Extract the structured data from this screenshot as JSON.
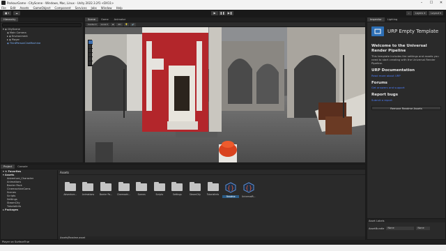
{
  "window": {
    "title": "ParkourGame - CityScene - Windows, Mac, Linux - Unity 2022.3.2f1 <DX11>"
  },
  "window_controls": {
    "min": "–",
    "max": "☐",
    "close": "✕"
  },
  "menu": [
    "File",
    "Edit",
    "Assets",
    "GameObject",
    "Component",
    "Services",
    "Jobs",
    "Window",
    "Help"
  ],
  "toolbar": {
    "left": [
      "■ ▾",
      "☁"
    ],
    "right": [
      "Layers ▾",
      "Layout ▾"
    ]
  },
  "hierarchy": {
    "tab": "Hierarchy",
    "rows": [
      {
        "label": "▾ ◈ CityScene",
        "indent": 0,
        "blue": false
      },
      {
        "label": "◈ Main Camera",
        "indent": 1,
        "blue": false
      },
      {
        "label": "▸ ◈ Environment",
        "indent": 1,
        "blue": false
      },
      {
        "label": "▸ ◈ Player",
        "indent": 1,
        "blue": false
      },
      {
        "label": "◈ ThirdPersonCineMachine",
        "indent": 1,
        "blue": true
      }
    ]
  },
  "scene": {
    "tabs": [
      "Scene",
      "Game",
      "Animator"
    ],
    "tools": [
      "Center ▾",
      "Local ▾",
      "⊞",
      "2D",
      "💡",
      "🔊"
    ]
  },
  "inspector": {
    "tabs": [
      "Inspector",
      "Lighting"
    ],
    "title": "URP Empty Template",
    "welcome_title": "Welcome to the Universal Render Pipeline",
    "welcome_text": "This template includes the settings and assets you need to start creating with the Universal Render Pipeline.",
    "doc_title": "URP Documentation",
    "doc_link": "Read more about URP",
    "forums_title": "Forums",
    "forums_link": "Get answers and support",
    "bugs_title": "Report bugs",
    "bugs_link": "Submit a report",
    "remove_button": "Remove Readme Assets",
    "asset_labels": "Asset Labels",
    "assetbundle_label": "AssetBundle",
    "assetbundle_value": "None",
    "assetbundle_value2": "None"
  },
  "project": {
    "tabs": [
      "Project",
      "Console"
    ],
    "tree": [
      {
        "label": "▾ ★ Favorites",
        "indent": 0,
        "bold": true
      },
      {
        "label": "▾ Assets",
        "indent": 0,
        "bold": true
      },
      {
        "label": "Adventure_Character",
        "indent": 1,
        "bold": false
      },
      {
        "label": "Animations",
        "indent": 1,
        "bold": false
      },
      {
        "label": "Barrier Pack",
        "indent": 1,
        "bold": false
      },
      {
        "label": "CinemachineCams",
        "indent": 1,
        "bold": false
      },
      {
        "label": "Scenes",
        "indent": 1,
        "bold": false
      },
      {
        "label": "Scripts",
        "indent": 1,
        "bold": false
      },
      {
        "label": "Settings",
        "indent": 1,
        "bold": false
      },
      {
        "label": "SteamCity",
        "indent": 1,
        "bold": false
      },
      {
        "label": "TutorialInfo",
        "indent": 1,
        "bold": false
      },
      {
        "label": "▸ Packages",
        "indent": 0,
        "bold": true
      }
    ],
    "breadcrumb": "Assets",
    "items": [
      {
        "label": "Adventure...",
        "kind": "folder",
        "selected": false
      },
      {
        "label": "Animations",
        "kind": "folder",
        "selected": false
      },
      {
        "label": "Barrier Pa...",
        "kind": "folder",
        "selected": false
      },
      {
        "label": "Cinemachi...",
        "kind": "folder",
        "selected": false
      },
      {
        "label": "Scenes",
        "kind": "folder",
        "selected": false
      },
      {
        "label": "Scripts",
        "kind": "folder",
        "selected": false
      },
      {
        "label": "Settings",
        "kind": "folder",
        "selected": false
      },
      {
        "label": "SteamCity",
        "kind": "folder",
        "selected": false
      },
      {
        "label": "TutorialInfo",
        "kind": "folder",
        "selected": false
      },
      {
        "label": "Readme",
        "kind": "asset",
        "selected": true
      },
      {
        "label": "UniversalR...",
        "kind": "asset",
        "selected": false
      }
    ],
    "path": "Assets/Readme.asset"
  },
  "status": {
    "text": "Player on SurfaceTrue"
  },
  "colors": {
    "accent": "#2d6fb5",
    "link": "#4c7eff",
    "scene_red": "#b3262b"
  }
}
